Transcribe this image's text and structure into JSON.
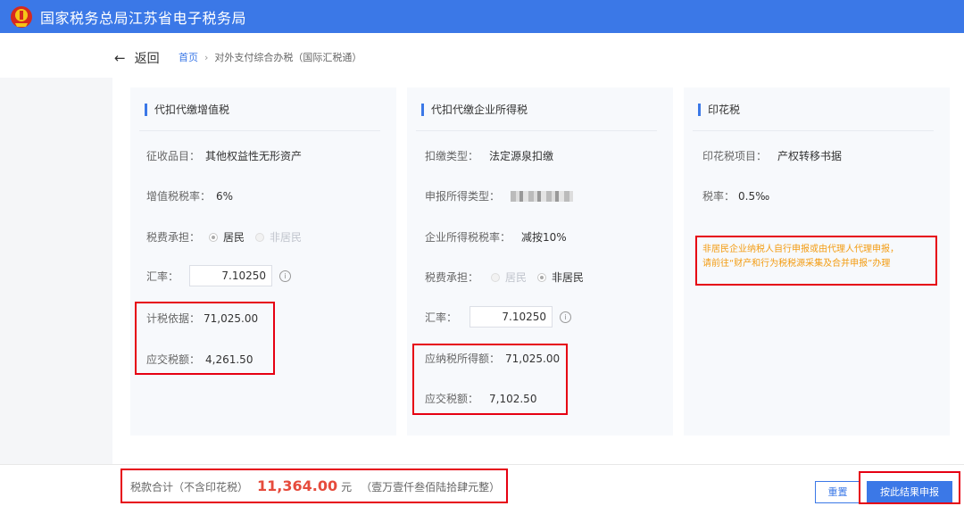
{
  "header": {
    "title": "国家税务总局江苏省电子税务局"
  },
  "nav": {
    "back_label": "返回",
    "breadcrumb_home": "首页",
    "breadcrumb_sep": "›",
    "breadcrumb_current": "对外支付综合办税（国际汇税通）"
  },
  "vat_card": {
    "title": "代扣代缴增值税",
    "item_label": "征收品目：",
    "item_value": "其他权益性无形资产",
    "rate_label": "增值税税率：",
    "rate_value": "6%",
    "bearer_label": "税费承担：",
    "bearer_options": [
      "居民",
      "非居民"
    ],
    "bearer_selected": "居民",
    "fx_label": "汇率：",
    "fx_value": "7.10250",
    "basis_label": "计税依据：",
    "basis_value": "71,025.00",
    "tax_label": "应交税额：",
    "tax_value": "4,261.50"
  },
  "cit_card": {
    "title": "代扣代缴企业所得税",
    "type_label": "扣缴类型：",
    "type_value": "法定源泉扣缴",
    "income_type_label": "申报所得类型：",
    "rate_label": "企业所得税税率：",
    "rate_value": "减按10%",
    "bearer_label": "税费承担：",
    "bearer_options": [
      "居民",
      "非居民"
    ],
    "bearer_selected": "非居民",
    "fx_label": "汇率：",
    "fx_value": "7.10250",
    "taxable_label": "应纳税所得额：",
    "taxable_value": "71,025.00",
    "tax_label": "应交税额：",
    "tax_value": "7,102.50"
  },
  "stamp_card": {
    "title": "印花税",
    "item_label": "印花税项目：",
    "item_value": "产权转移书据",
    "rate_label": "税率：",
    "rate_value": "0.5‰",
    "warning_line1": "非居民企业纳税人自行申报或由代理人代理申报，",
    "warning_line2": "请前往“财产和行为税税源采集及合并申报”办理"
  },
  "footer": {
    "total_label": "税款合计（不含印花税）",
    "total_amount": "11,364.00",
    "total_unit": "元",
    "total_uppercase": "（壹万壹仟叁佰陆拾肆元整）",
    "reset_label": "重置",
    "submit_label": "按此结果申报"
  },
  "colors": {
    "primary": "#3b78e7",
    "highlight_box": "#e60012",
    "warning": "#f39c12",
    "amount": "#e64b3c"
  },
  "icons": {
    "emblem": "tax-emblem-icon",
    "back": "arrow-left-icon",
    "info": "info-circle-icon",
    "blurred": "redacted-value"
  }
}
